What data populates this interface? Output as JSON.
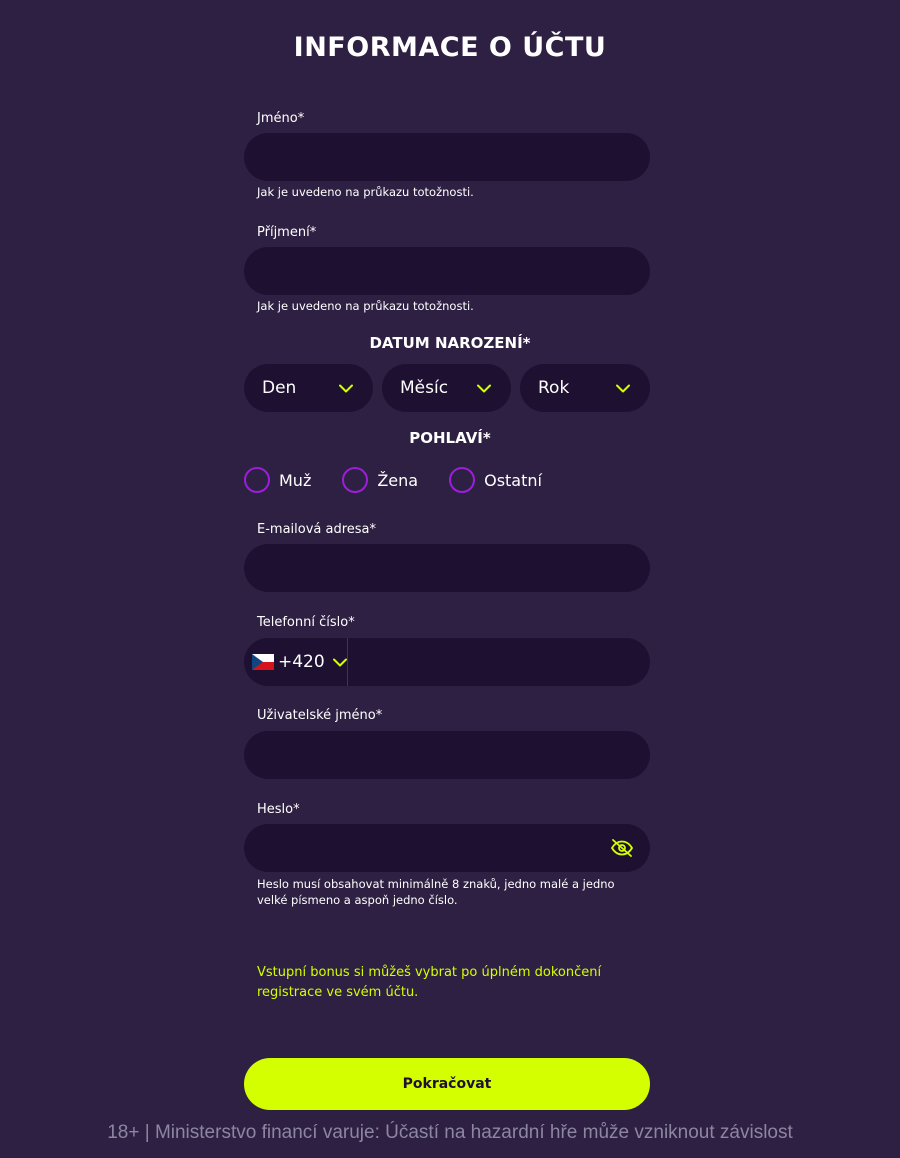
{
  "title": "INFORMACE O ÚČTU",
  "first_name": {
    "label": "Jméno*",
    "value": "",
    "hint": "Jak je uvedeno na průkazu totožnosti."
  },
  "last_name": {
    "label": "Příjmení*",
    "value": "",
    "hint": "Jak je uvedeno na průkazu totožnosti."
  },
  "birth_date": {
    "heading": "DATUM NAROZENÍ*",
    "day": "Den",
    "month": "Měsíc",
    "year": "Rok"
  },
  "gender": {
    "heading": "POHLAVÍ*",
    "options": [
      "Muž",
      "Žena",
      "Ostatní"
    ]
  },
  "email": {
    "label": "E-mailová adresa*",
    "value": ""
  },
  "phone": {
    "label": "Telefonní číslo*",
    "country_code": "+420",
    "value": ""
  },
  "username": {
    "label": "Uživatelské jméno*",
    "value": ""
  },
  "password": {
    "label": "Heslo*",
    "value": "",
    "hint": "Heslo musí obsahovat minimálně 8 znaků, jedno malé a jedno velké písmeno a aspoň jedno číslo."
  },
  "bonus_note": "Vstupní bonus si můžeš vybrat po úplném dokončení registrace ve svém účtu.",
  "continue_button": "Pokračovat",
  "footer": "18+ | Ministerstvo financí varuje: Účastí na hazardní hře může vzniknout závislost",
  "colors": {
    "background": "#2e2042",
    "field": "#1d1030",
    "accent": "#d4ff00",
    "radio": "#9b1fd9"
  },
  "icons": {
    "dropdown": "chevron-down-icon",
    "password_toggle": "eye-off-icon",
    "flag": "czech-flag-icon"
  }
}
